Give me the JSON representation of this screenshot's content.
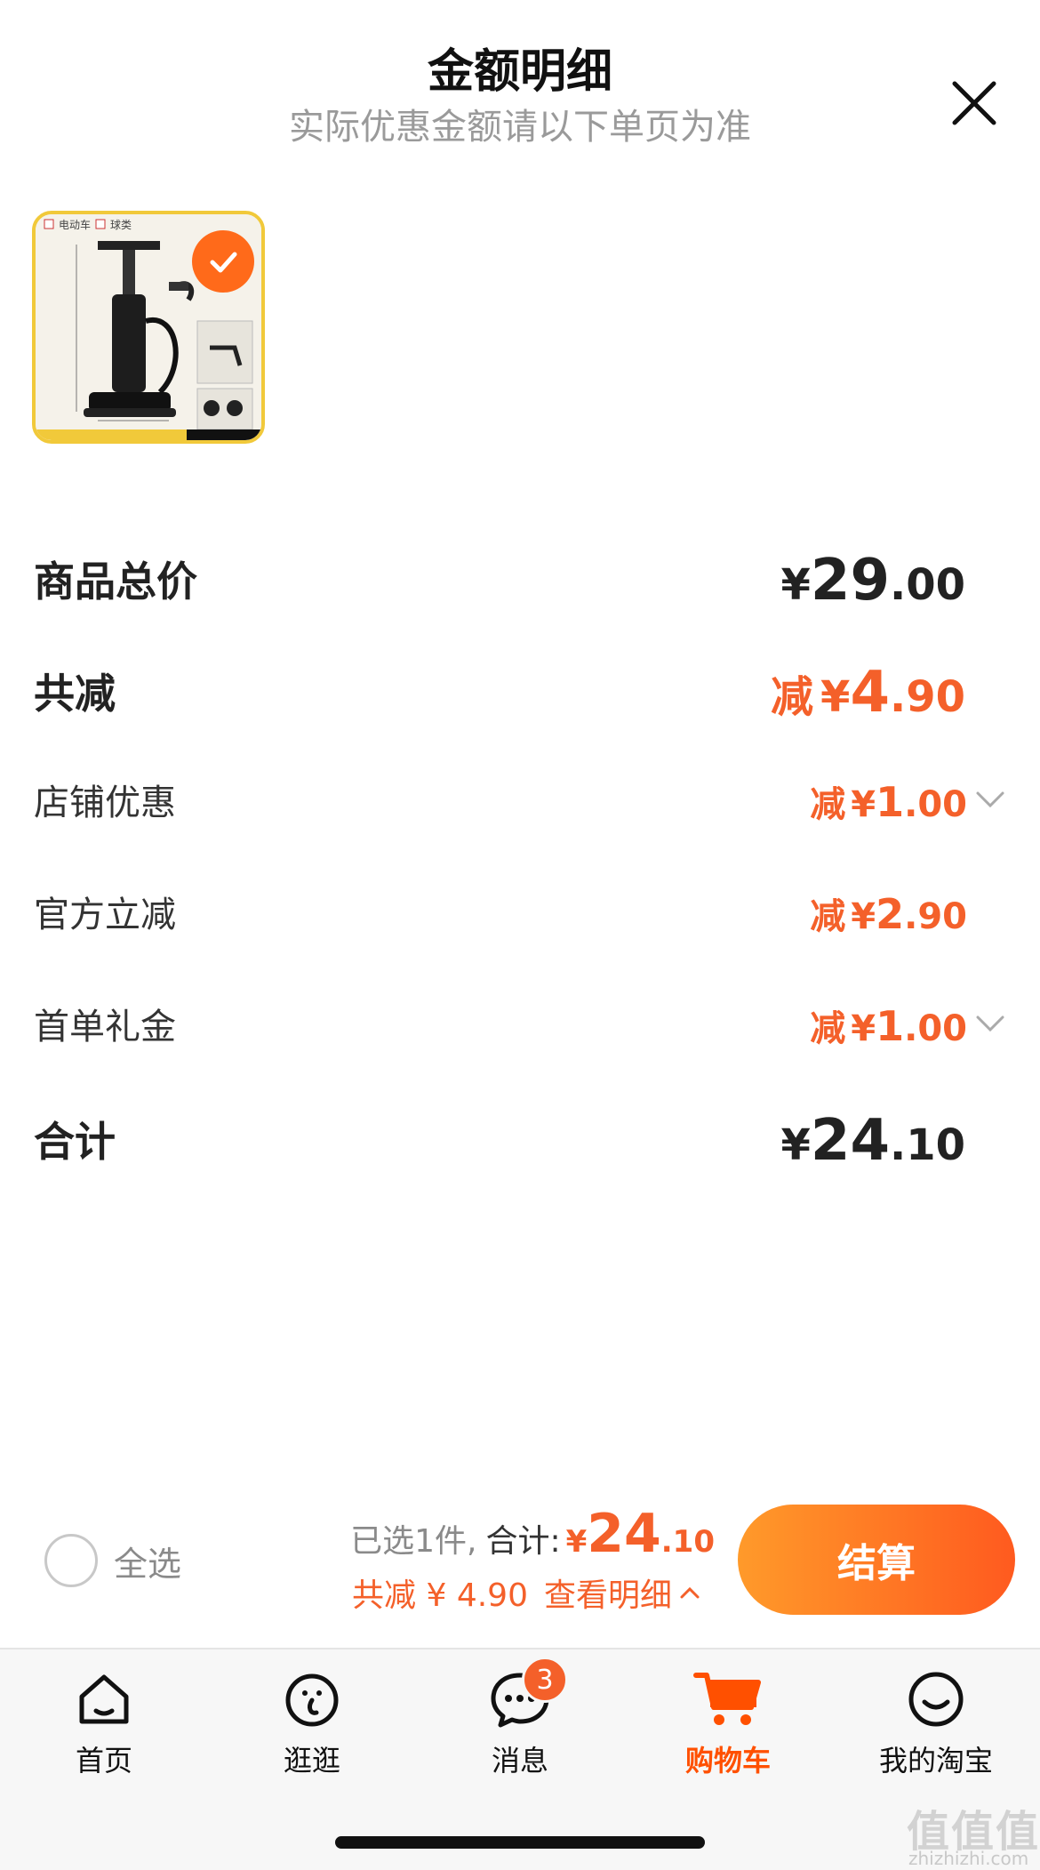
{
  "header": {
    "title": "金额明细",
    "subtitle": "实际优惠金额请以下单页为准",
    "close_icon": "close-icon"
  },
  "product": {
    "tag_left": "电动车",
    "tag_right": "球类",
    "selected": true
  },
  "rows": {
    "total_price": {
      "label": "商品总价",
      "yen": "¥",
      "int": "29",
      "dec": ".00"
    },
    "total_discount": {
      "label": "共减",
      "prefix": "减",
      "yen": "¥",
      "int": "4",
      "dec": ".90"
    },
    "shop_discount": {
      "label": "店铺优惠",
      "prefix": "减",
      "yen": "¥",
      "int": "1",
      "dec": ".00"
    },
    "official_discount": {
      "label": "官方立减",
      "prefix": "减",
      "yen": "¥",
      "int": "2",
      "dec": ".90"
    },
    "first_order_gift": {
      "label": "首单礼金",
      "prefix": "减",
      "yen": "¥",
      "int": "1",
      "dec": ".00"
    },
    "grand_total": {
      "label": "合计",
      "yen": "¥",
      "int": "24",
      "dec": ".10"
    }
  },
  "checkout_bar": {
    "select_all_label": "全选",
    "selected_count": "已选1件,",
    "total_label": "合计:",
    "yen": "¥",
    "total_int": "24",
    "total_dec": ".10",
    "discount_text": "共减 ¥ 4.90",
    "view_detail": "查看明细",
    "checkout_label": "结算"
  },
  "tabbar": {
    "tabs": [
      {
        "label": "首页",
        "icon": "home-icon"
      },
      {
        "label": "逛逛",
        "icon": "browse-icon"
      },
      {
        "label": "消息",
        "icon": "message-icon",
        "badge": "3"
      },
      {
        "label": "购物车",
        "icon": "cart-icon",
        "active": true
      },
      {
        "label": "我的淘宝",
        "icon": "profile-icon"
      }
    ]
  },
  "watermark": {
    "main": "值值值",
    "sub": "zhizhizhi.com"
  },
  "colors": {
    "accent": "#f4602a",
    "brand": "#ff5000",
    "gradient_start": "#ff9a2a",
    "gradient_end": "#ff5a1f"
  }
}
